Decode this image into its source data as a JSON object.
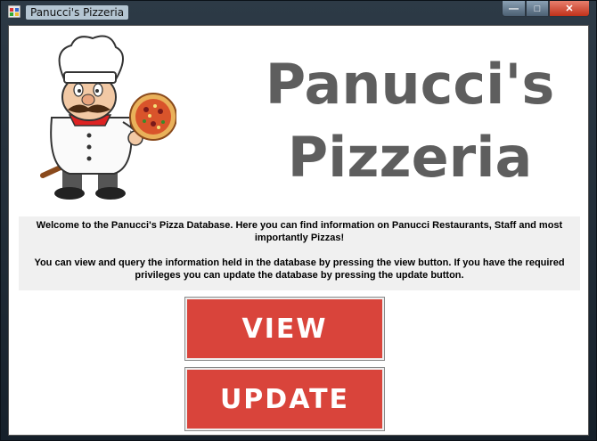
{
  "window": {
    "title": "Panucci's Pizzeria",
    "controls": {
      "minimize": "—",
      "maximize": "□",
      "close": "✕"
    }
  },
  "heading": {
    "line1": "Panucci's",
    "line2": "Pizzeria"
  },
  "info": {
    "paragraph1": "Welcome to the Panucci's Pizza Database. Here you can find information on Panucci Restaurants, Staff and most importantly Pizzas!",
    "paragraph2": "You can view and query the information held in the database by pressing the view button.  If you have the required privileges you can update the database by pressing the update button."
  },
  "buttons": {
    "view": "VIEW",
    "update": "UPDATE"
  },
  "colors": {
    "button_red": "#d9443b",
    "heading_gray": "#5e5e5e"
  },
  "icons": [
    "app-icon",
    "chef-with-pizza-image"
  ]
}
